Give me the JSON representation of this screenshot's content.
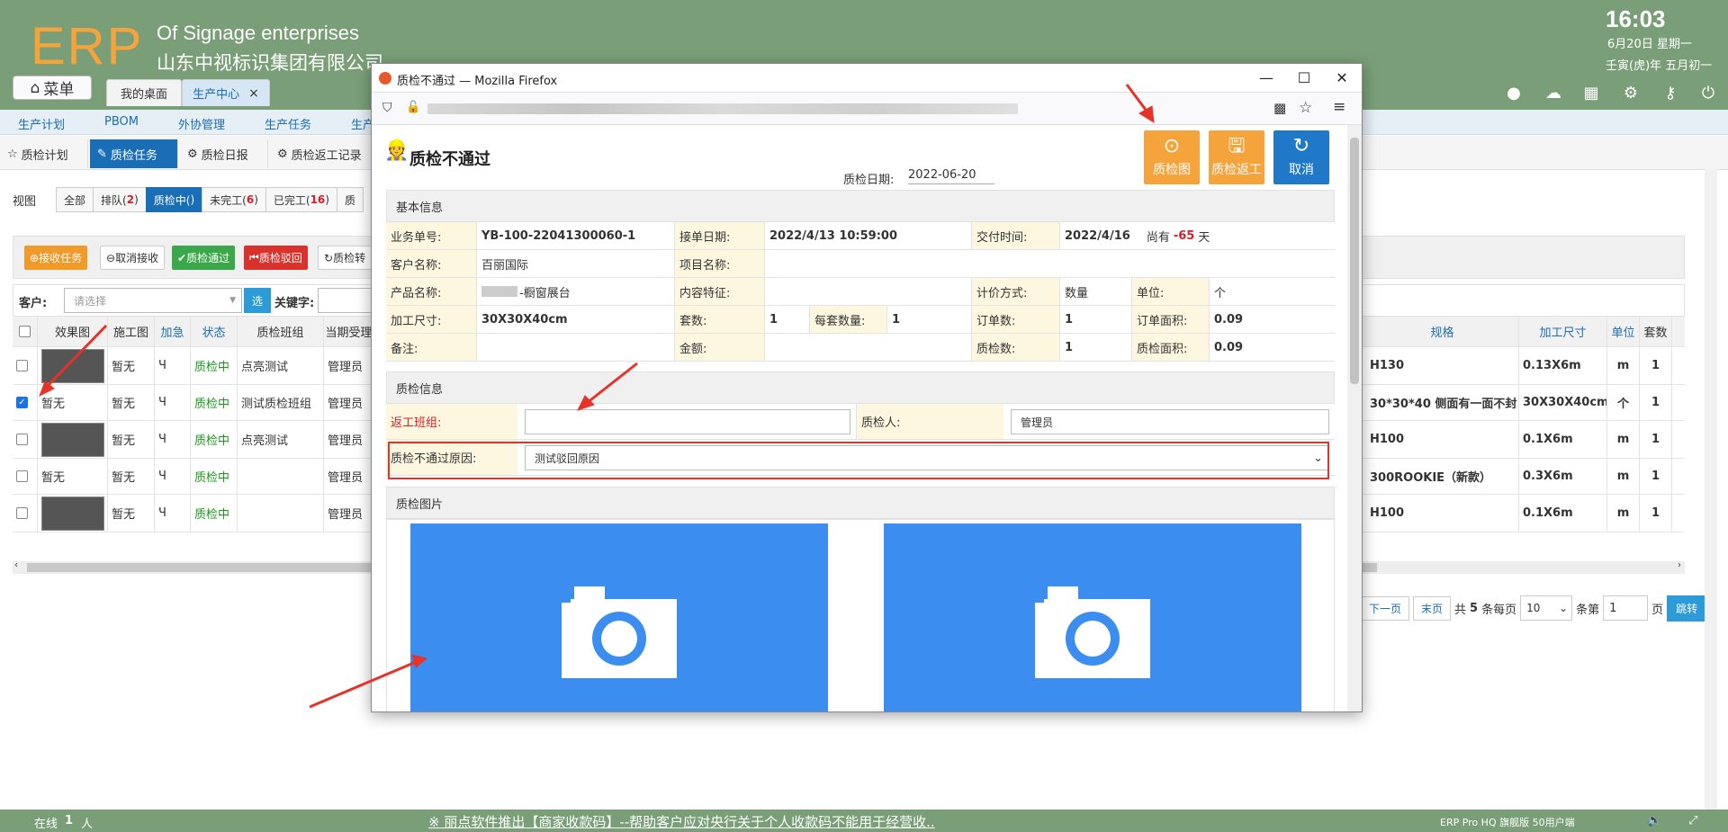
{
  "header": {
    "logo": "ERP",
    "company_en": "Of Signage enterprises",
    "company_cn": "山东中视标识集团有限公司",
    "time": "16:03",
    "date": "6月20日 星期一",
    "lunar": "壬寅(虎)年 五月初一",
    "menu_label": "菜单",
    "tabs": [
      {
        "label": "我的桌面"
      },
      {
        "label": "生产中心",
        "close": "×"
      }
    ],
    "icons": [
      "user-icon",
      "cloud-icon",
      "grid-icon",
      "gear-icon",
      "key-icon",
      "power-icon"
    ]
  },
  "subnav": {
    "items": [
      "生产计划",
      "PBOM",
      "外协管理",
      "生产任务",
      "生产"
    ]
  },
  "subtabs": {
    "items": [
      {
        "label": "质检计划",
        "icon": "star-icon"
      },
      {
        "label": "质检任务",
        "icon": "edit-icon"
      },
      {
        "label": "质检日报",
        "icon": "gear-icon"
      },
      {
        "label": "质检返工记录",
        "icon": "gear-icon"
      }
    ]
  },
  "view": {
    "label": "视图",
    "buttons": [
      {
        "label": "全部",
        "count": ""
      },
      {
        "label": "排队(",
        "count": "2",
        "suffix": ")"
      },
      {
        "label": "质检中(",
        "count": "",
        "suffix": ")"
      },
      {
        "label": "未完工(",
        "count": "6",
        "suffix": ")"
      },
      {
        "label": "已完工(",
        "count": "16",
        "suffix": ")"
      },
      {
        "label": "质",
        "count": ""
      }
    ]
  },
  "actions": {
    "receive": "接收任务",
    "cancel_receive": "取消接收",
    "pass": "质检通过",
    "reject": "质检驳回",
    "transfer": "质检转"
  },
  "filter": {
    "customer_label": "客户:",
    "customer_placeholder": "请选择",
    "select_btn": "选",
    "keyword_label": "关键字:"
  },
  "grid": {
    "headers_left": [
      "效果图",
      "施工图",
      "加急",
      "状态",
      "质检班组",
      "当期受理"
    ],
    "headers_right": [
      "规格",
      "加工尺寸",
      "单位",
      "套数"
    ],
    "rows": [
      {
        "img": true,
        "construct": "暂无",
        "urgent": "Ч",
        "status": "质检中",
        "team": "点亮测试",
        "handler": "管理员",
        "spec": "H130",
        "size": "0.13X6m",
        "unit": "m",
        "sets": "1",
        "checked": false
      },
      {
        "img": false,
        "effect": "暂无",
        "construct": "暂无",
        "urgent": "Ч",
        "status": "质检中",
        "team": "测试质检班组",
        "handler": "管理员",
        "spec": "30*30*40 侧面有一面不封",
        "size": "30X30X40cm",
        "unit": "个",
        "sets": "1",
        "checked": true
      },
      {
        "img": true,
        "construct": "暂无",
        "urgent": "Ч",
        "status": "质检中",
        "team": "点亮测试",
        "handler": "管理员",
        "spec": "H100",
        "size": "0.1X6m",
        "unit": "m",
        "sets": "1",
        "checked": false
      },
      {
        "img": false,
        "effect": "暂无",
        "construct": "暂无",
        "urgent": "Ч",
        "status": "质检中",
        "team": "",
        "handler": "管理员",
        "spec": "300ROOKIE（新款）",
        "size": "0.3X6m",
        "unit": "m",
        "sets": "1",
        "checked": false
      },
      {
        "img": true,
        "construct": "暂无",
        "urgent": "Ч",
        "status": "质检中",
        "team": "",
        "handler": "管理员",
        "spec": "H100",
        "size": "0.1X6m",
        "unit": "m",
        "sets": "1",
        "checked": false
      }
    ]
  },
  "pager": {
    "next": "下一页",
    "last": "末页",
    "total_prefix": "共",
    "total": "5",
    "total_mid": "条每页",
    "per_page": "10",
    "goto_prefix": "条第",
    "page": "1",
    "goto_suffix": "页",
    "go": "跳转"
  },
  "footer": {
    "online_label": "在线",
    "online_count": "1",
    "online_unit": "人",
    "marquee": "※ 丽点软件推出【商家收款码】--帮助客户应对央行关于个人收款码不能用于经营收..",
    "version": "ERP Pro HQ 旗舰版 50用户端"
  },
  "popup": {
    "window_title": "质检不通过 — Mozilla Firefox",
    "title": "质检不通过",
    "date_label": "质检日期:",
    "date": "2022-06-20",
    "buttons": {
      "qc_image": "质检图",
      "qc_rework": "质检返工",
      "cancel": "取消"
    },
    "basic_section": "基本信息",
    "basic": {
      "order_no_label": "业务单号:",
      "order_no": "YB-100-22041300060-1",
      "receive_date_label": "接单日期:",
      "receive_date": "2022/4/13 10:59:00",
      "delivery_label": "交付时间:",
      "delivery": "2022/4/16",
      "remain_prefix": "尚有",
      "remain_days": "-65",
      "remain_suffix": "天",
      "customer_label": "客户名称:",
      "customer": "百丽国际",
      "project_label": "项目名称:",
      "project": "",
      "product_label": "产品名称:",
      "product": "-橱窗展台",
      "content_label": "内容特征:",
      "content": "",
      "pricing_label": "计价方式:",
      "pricing": "数量",
      "unit_label": "单位:",
      "unit": "个",
      "size_label": "加工尺寸:",
      "size": "30X30X40cm",
      "sets_label": "套数:",
      "sets": "1",
      "per_set_label": "每套数量:",
      "per_set": "1",
      "order_qty_label": "订单数:",
      "order_qty": "1",
      "order_area_label": "订单面积:",
      "order_area": "0.09",
      "note_label": "备注:",
      "note": "",
      "amount_label": "金额:",
      "amount": "",
      "qc_qty_label": "质检数:",
      "qc_qty": "1",
      "qc_area_label": "质检面积:",
      "qc_area": "0.09"
    },
    "qc_section": "质检信息",
    "qc": {
      "rework_team_label": "返工班组:",
      "rework_team": "",
      "inspector_label": "质检人:",
      "inspector": "管理员",
      "reject_reason_label": "质检不通过原因:",
      "reject_reason": "测试驳回原因"
    },
    "photo_section": "质检图片"
  }
}
